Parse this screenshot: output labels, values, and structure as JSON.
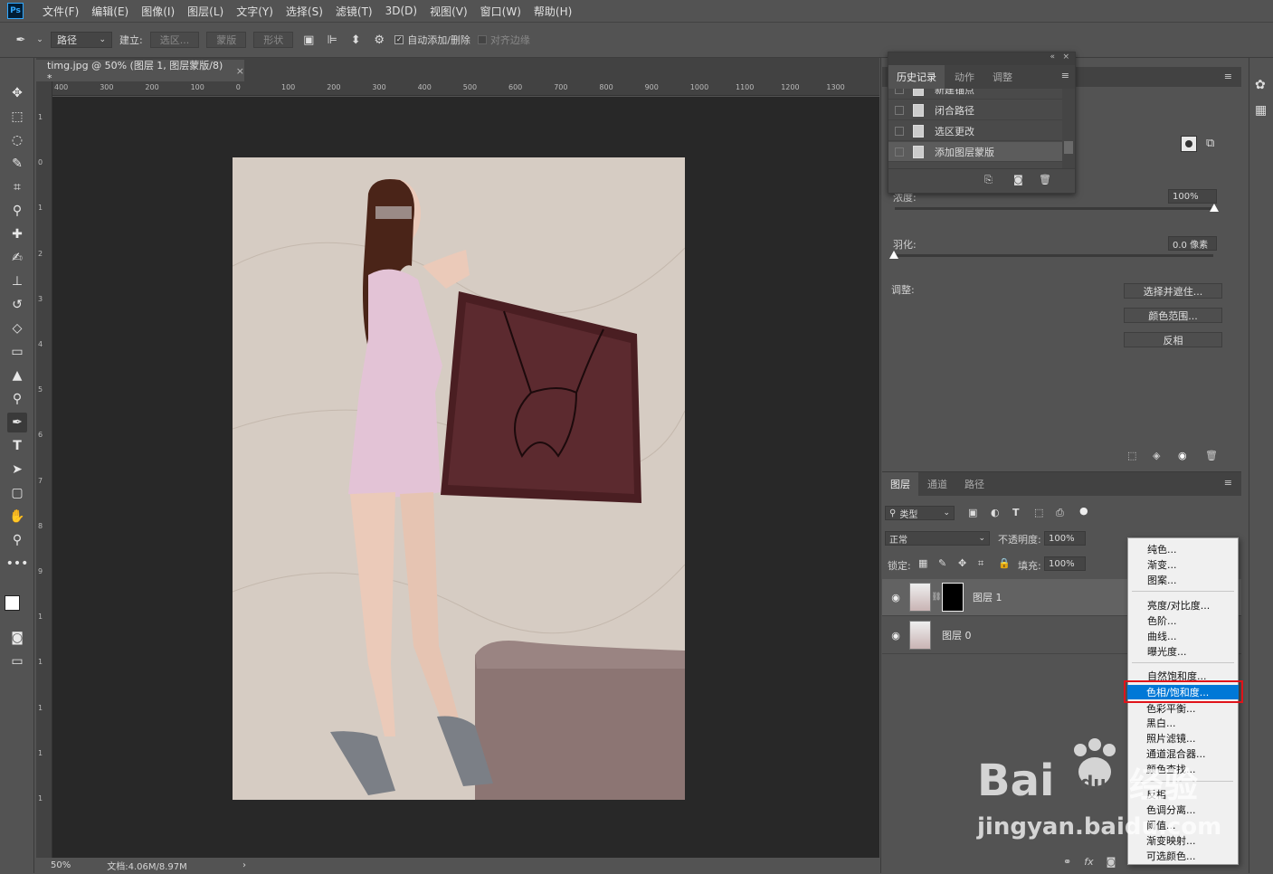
{
  "app": {
    "logo": "Ps"
  },
  "menu": [
    "文件(F)",
    "编辑(E)",
    "图像(I)",
    "图层(L)",
    "文字(Y)",
    "选择(S)",
    "滤镜(T)",
    "3D(D)",
    "视图(V)",
    "窗口(W)",
    "帮助(H)"
  ],
  "options": {
    "mode": "路径",
    "make_label": "建立:",
    "selection_btn": "选区...",
    "mask_btn": "蒙版",
    "shape_btn": "形状",
    "auto_add": "自动添加/删除",
    "align_edges": "对齐边缘"
  },
  "document": {
    "tab_title": "timg.jpg @ 50% (图层 1, 图层蒙版/8) *",
    "ruler_h": [
      "400",
      "300",
      "200",
      "100",
      "0",
      "100",
      "200",
      "300",
      "400",
      "500",
      "600",
      "700",
      "800",
      "900",
      "1000",
      "1100",
      "1200",
      "1300"
    ],
    "ruler_v": [
      "1",
      "0",
      "1",
      "2",
      "3",
      "4",
      "5",
      "6",
      "7",
      "8",
      "9",
      "1",
      "1",
      "1",
      "1",
      "1"
    ],
    "zoom": "50%",
    "doc_size": "文档:4.06M/8.97M"
  },
  "history": {
    "tabs": [
      "历史记录",
      "动作",
      "调整"
    ],
    "rows": [
      "新建锚点",
      "闭合路径",
      "选区更改",
      "添加图层蒙版"
    ]
  },
  "properties": {
    "density_label": "浓度:",
    "density_value": "100%",
    "feather_label": "羽化:",
    "feather_value": "0.0 像素",
    "adjust_label": "调整:",
    "btn_select_mask": "选择并遮住...",
    "btn_color_range": "颜色范围...",
    "btn_invert": "反相"
  },
  "layers": {
    "tabs": [
      "图层",
      "通道",
      "路径"
    ],
    "filter_kind": "类型",
    "blend_mode": "正常",
    "opacity_label": "不透明度:",
    "opacity_value": "100%",
    "lock_label": "锁定:",
    "fill_label": "填充:",
    "fill_value": "100%",
    "rows": [
      "图层 1",
      "图层 0"
    ]
  },
  "dropdown": {
    "group1": [
      "纯色...",
      "渐变...",
      "图案..."
    ],
    "group2": [
      "亮度/对比度...",
      "色阶...",
      "曲线...",
      "曝光度..."
    ],
    "group3": [
      "自然饱和度...",
      "色相/饱和度...",
      "色彩平衡...",
      "黑白...",
      "照片滤镜...",
      "通道混合器...",
      "颜色查找..."
    ],
    "group4": [
      "反相",
      "色调分离...",
      "阈值...",
      "渐变映射...",
      "可选颜色..."
    ],
    "highlighted": "色相/饱和度..."
  },
  "watermark": {
    "brand": "Bai",
    "brand2": "du",
    "brand3": "经验",
    "url": "jingyan.baidu.com"
  },
  "colors": {
    "highlight": "#0078d7",
    "annotation": "#e0131a",
    "panel": "#535353"
  }
}
